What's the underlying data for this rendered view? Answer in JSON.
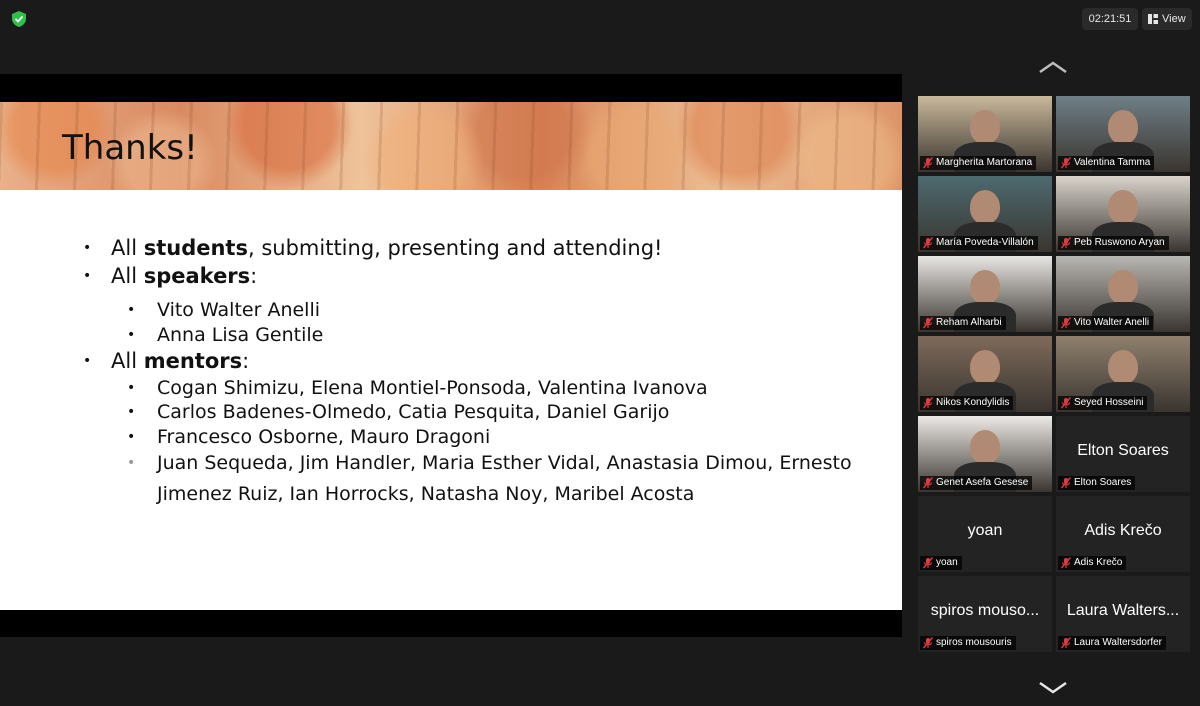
{
  "topbar": {
    "timer": "02:21:51",
    "view_label": "View",
    "icons": [
      "shield-check-icon",
      "view-grid-icon"
    ]
  },
  "slide": {
    "title": "Thanks!",
    "bullets": [
      {
        "pre": "All ",
        "bold": "students",
        "post": ", submitting, presenting and attending!"
      },
      {
        "pre": "All ",
        "bold": "speakers",
        "post": ":"
      },
      {
        "pre": "All ",
        "bold": "mentors",
        "post": ":"
      }
    ],
    "speakers": [
      "Vito Walter Anelli",
      "Anna Lisa Gentile"
    ],
    "mentors": [
      "Cogan Shimizu, Elena Montiel-Ponsoda, Valentina Ivanova",
      "Carlos Badenes-Olmedo, Catia Pesquita, Daniel Garijo",
      "Francesco Osborne, Mauro Dragoni",
      "Juan Sequeda, Jim Handler, Maria Esther Vidal, Anastasia Dimou, Ernesto",
      "Jimenez Ruiz, Ian Horrocks, Natasha Noy, Maribel Acosta"
    ]
  },
  "participants": [
    {
      "name": "Margherita Martorana",
      "video": true,
      "bg": "#c9b89a"
    },
    {
      "name": "Valentina Tamma",
      "video": true,
      "bg": "#6f7f86"
    },
    {
      "name": "María Poveda-Villalón",
      "video": true,
      "bg": "#4d6a70",
      "active": true
    },
    {
      "name": "Peb Ruswono Aryan",
      "video": true,
      "bg": "#d9d3cc"
    },
    {
      "name": "Reham Alharbi",
      "video": true,
      "bg": "#e8e6e3"
    },
    {
      "name": "Vito Walter Anelli",
      "video": true,
      "bg": "#b9b7b3"
    },
    {
      "name": "Nikos Kondylidis",
      "video": true,
      "bg": "#7e6a5a"
    },
    {
      "name": "Seyed Hosseini",
      "video": true,
      "bg": "#8f806d"
    },
    {
      "name": "Genet Asefa Gesese",
      "video": true,
      "bg": "#ece9e6"
    },
    {
      "name": "Elton Soares",
      "display": "Elton Soares",
      "video": false
    },
    {
      "name": "yoan",
      "display": "yoan",
      "video": false
    },
    {
      "name": "Adis Krečo",
      "display": "Adis Krečo",
      "video": false
    },
    {
      "name": "spiros mousouris",
      "display": "spiros mouso...",
      "video": false
    },
    {
      "name": "Laura Waltersdorfer",
      "display": "Laura Walters...",
      "video": false
    }
  ],
  "colors": {
    "active_outline": "#8cc63f",
    "mute_red": "#e0393e",
    "shield_green": "#2fbf4a"
  }
}
